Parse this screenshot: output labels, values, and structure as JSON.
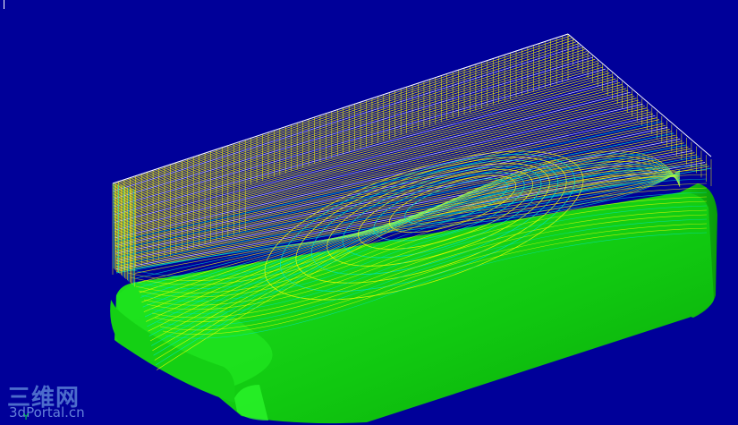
{
  "viewport": {
    "background_color": "#000099",
    "part_color": "#11dd11",
    "toolpath_colors": [
      "#ffff00",
      "#00e5c8",
      "#ffffff"
    ]
  },
  "watermark": {
    "logo_text": "三维网",
    "site_text": "3dPortal.cn"
  },
  "axis_triad": {
    "y_label": "Y"
  }
}
